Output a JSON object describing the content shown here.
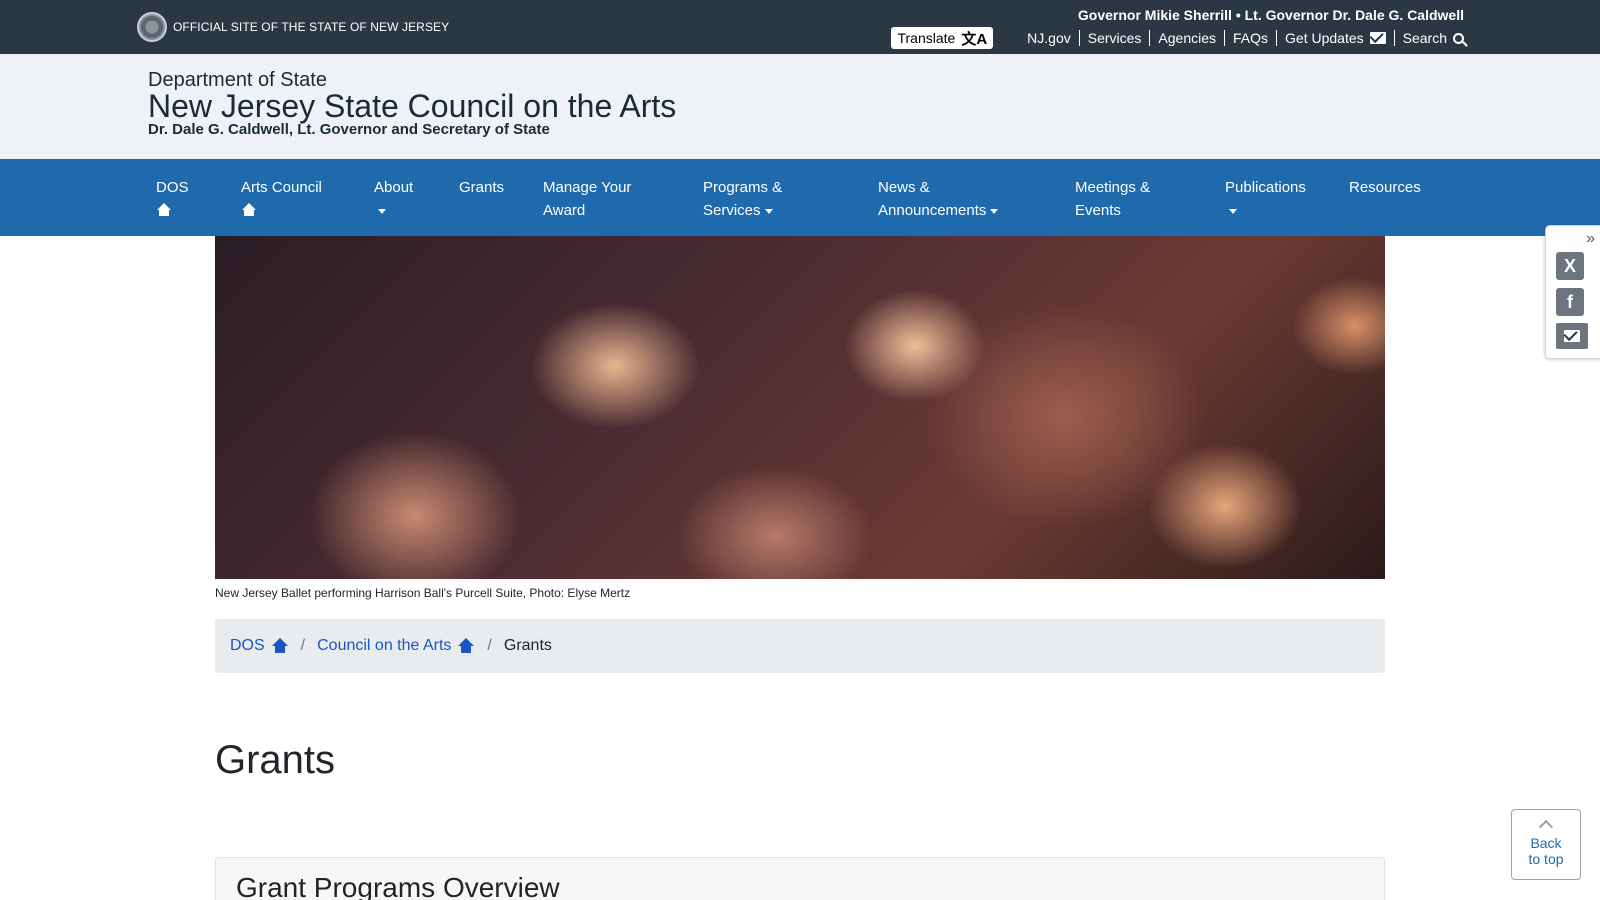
{
  "statebar": {
    "official_text": "OFFICIAL SITE OF THE STATE OF NEW JERSEY",
    "governor_line": "Governor Mikie Sherrill • Lt. Governor Dr. Dale G. Caldwell",
    "translate_label": "Translate",
    "links": [
      "NJ.gov",
      "Services",
      "Agencies",
      "FAQs",
      "Get Updates",
      "Search"
    ]
  },
  "header": {
    "department": "Department of State",
    "title": "New Jersey State Council on the Arts",
    "subtitle": "Dr. Dale G. Caldwell, Lt. Governor and Secretary of State"
  },
  "nav": {
    "items": [
      {
        "line1": "DOS",
        "line2": ""
      },
      {
        "line1": "Arts Council",
        "line2": ""
      },
      {
        "line1": "About",
        "line2": ""
      },
      {
        "line1": "Grants",
        "line2": ""
      },
      {
        "line1": "Manage Your",
        "line2": "Award"
      },
      {
        "line1": "Programs &",
        "line2": "Services"
      },
      {
        "line1": "News &",
        "line2": "Announcements"
      },
      {
        "line1": "Meetings &",
        "line2": "Events"
      },
      {
        "line1": "Publications",
        "line2": ""
      },
      {
        "line1": "Resources",
        "line2": ""
      }
    ]
  },
  "hero": {
    "caption": "New Jersey Ballet performing Harrison Ball's Purcell Suite, Photo: Elyse Mertz"
  },
  "breadcrumb": {
    "items": [
      "DOS",
      "Council on the Arts",
      "Grants"
    ]
  },
  "page": {
    "title": "Grants",
    "section_title": "Grant Programs Overview"
  },
  "share": {
    "twitter": "X",
    "facebook": "f"
  },
  "backtotop": {
    "line1": "Back",
    "line2": "to top"
  },
  "colors": {
    "statebar": "#2b3844",
    "nav": "#1f6aad",
    "link": "#1a55c4"
  }
}
